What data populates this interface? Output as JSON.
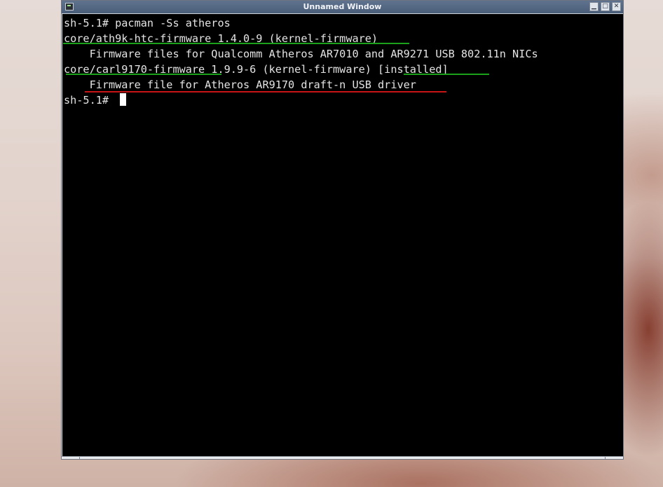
{
  "window": {
    "title": "Unnamed Window",
    "buttons": {
      "minimize": "▁",
      "maximize": "□",
      "close": "✕"
    }
  },
  "terminal": {
    "lines": [
      "sh-5.1# pacman -Ss atheros",
      "core/ath9k-htc-firmware 1.4.0-9 (kernel-firmware)",
      "    Firmware files for Qualcomm Atheros AR7010 and AR9271 USB 802.11n NICs",
      "core/carl9170-firmware 1.9.9-6 (kernel-firmware) [installed]",
      "    Firmware file for Atheros AR9170 draft-n USB driver",
      "sh-5.1# "
    ]
  },
  "colors": {
    "terminal_bg": "#000000",
    "terminal_fg": "#e4e4e4",
    "underline_green": "#1aa31a",
    "underline_red": "#c81414",
    "titlebar": "#52667f"
  }
}
